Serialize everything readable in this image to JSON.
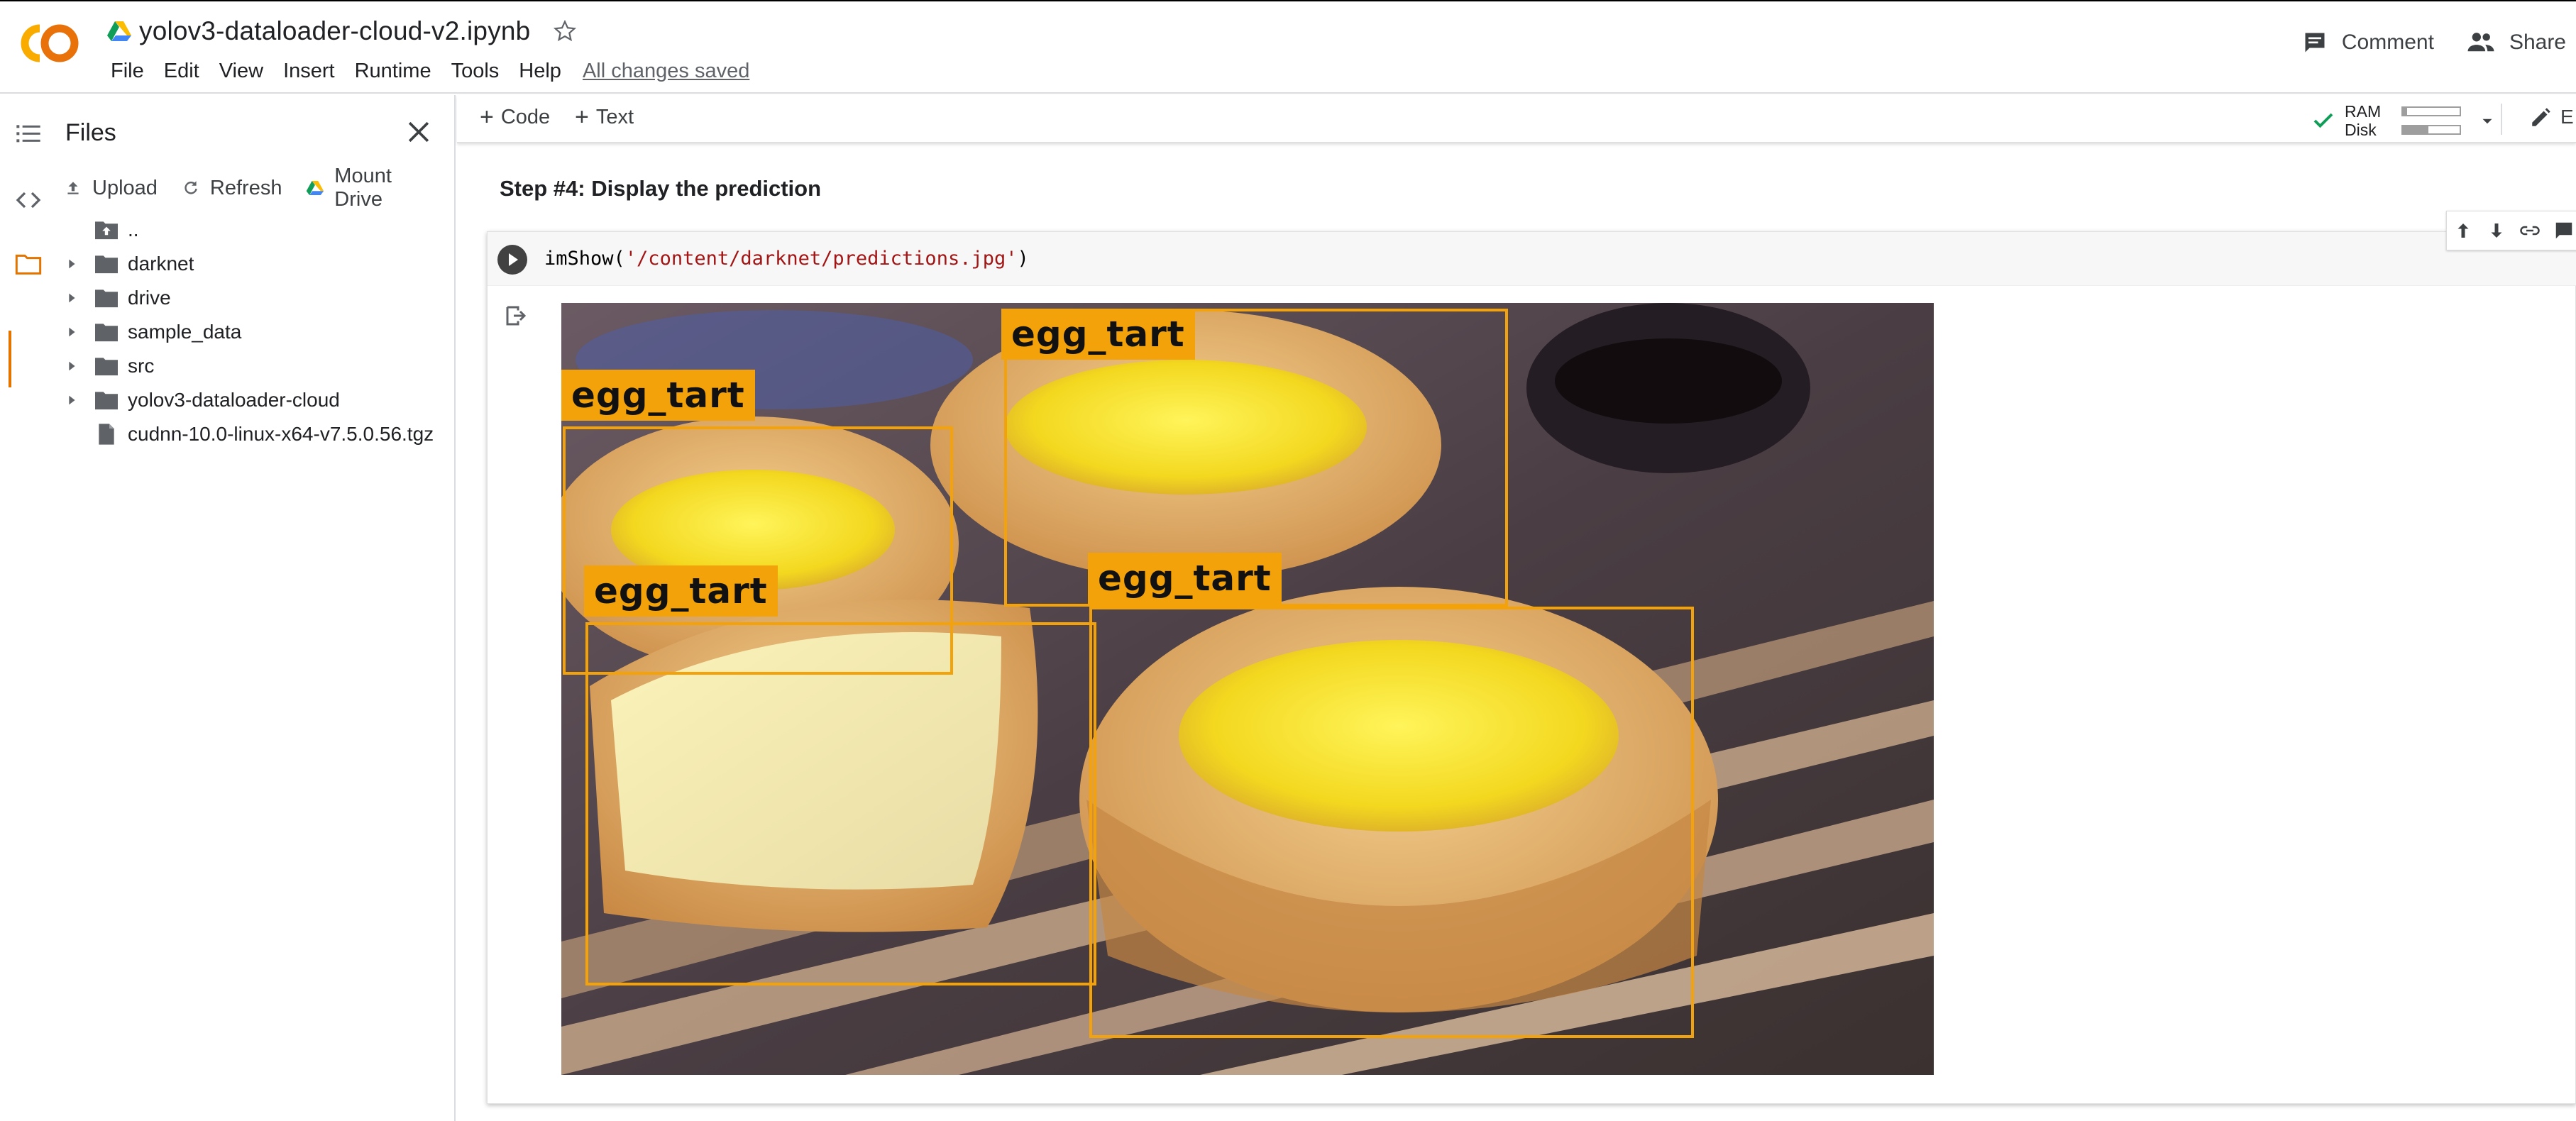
{
  "header": {
    "notebook_title": "yolov3-dataloader-cloud-v2.ipynb",
    "menu": [
      "File",
      "Edit",
      "View",
      "Insert",
      "Runtime",
      "Tools",
      "Help"
    ],
    "save_status": "All changes saved",
    "comment_label": "Comment",
    "share_label": "Share"
  },
  "files_panel": {
    "title": "Files",
    "actions": {
      "upload": "Upload",
      "refresh": "Refresh",
      "mount": "Mount Drive"
    },
    "items": [
      {
        "name": "..",
        "kind": "parent"
      },
      {
        "name": "darknet",
        "kind": "folder"
      },
      {
        "name": "drive",
        "kind": "folder"
      },
      {
        "name": "sample_data",
        "kind": "folder"
      },
      {
        "name": "src",
        "kind": "folder"
      },
      {
        "name": "yolov3-dataloader-cloud",
        "kind": "folder"
      },
      {
        "name": "cudnn-10.0-linux-x64-v7.5.0.56.tgz",
        "kind": "file"
      }
    ]
  },
  "toolbar": {
    "add_code": "Code",
    "add_text": "Text",
    "ram_label": "RAM",
    "disk_label": "Disk",
    "ram_usage": 0.08,
    "disk_usage": 0.45,
    "edit_label": "E"
  },
  "notebook": {
    "section_heading": "Step #4: Display the prediction",
    "code": {
      "fn": "imShow(",
      "arg": "'/content/darknet/predictions.jpg'",
      "close": ")"
    },
    "detections": [
      {
        "label": "egg_tart"
      },
      {
        "label": "egg_tart"
      },
      {
        "label": "egg_tart"
      },
      {
        "label": "egg_tart"
      }
    ]
  },
  "colors": {
    "accent": "#e37400",
    "detection": "#f4a20a",
    "run_button": "#424242"
  }
}
